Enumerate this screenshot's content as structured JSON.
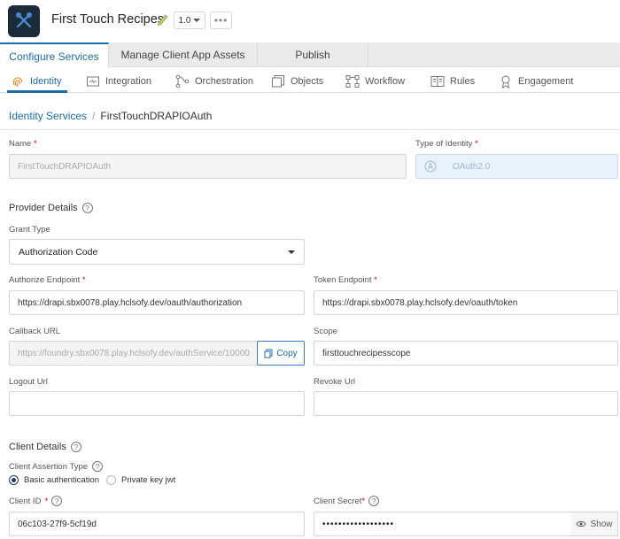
{
  "header": {
    "app_name": "First Touch Recipes",
    "version": "1.0",
    "more": "•••"
  },
  "main_tabs": [
    {
      "label": "Configure Services",
      "active": true
    },
    {
      "label": "Manage Client App Assets",
      "active": false
    },
    {
      "label": "Publish",
      "active": false
    }
  ],
  "sub_tabs": [
    {
      "label": "Identity",
      "icon": "fingerprint-icon",
      "active": true
    },
    {
      "label": "Integration",
      "icon": "integration-icon"
    },
    {
      "label": "Orchestration",
      "icon": "orchestration-icon"
    },
    {
      "label": "Objects",
      "icon": "objects-icon"
    },
    {
      "label": "Workflow",
      "icon": "workflow-icon"
    },
    {
      "label": "Rules",
      "icon": "rules-icon"
    },
    {
      "label": "Engagement",
      "icon": "engagement-icon"
    }
  ],
  "breadcrumb": {
    "parent": "Identity Services",
    "separator": "/",
    "current": "FirstTouchDRAPIOAuth"
  },
  "form": {
    "name_label": "Name",
    "name_value": "FirstTouchDRAPIOAuth",
    "type_label": "Type of Identity",
    "type_value": "OAuth2.0",
    "required_mark": "*",
    "provider_details_title": "Provider Details",
    "grant_type_label": "Grant Type",
    "grant_type_value": "Authorization Code",
    "authorize_endpoint_label": "Authorize Endpoint",
    "authorize_endpoint_value": "https://drapi.sbx0078.play.hclsofy.dev/oauth/authorization",
    "token_endpoint_label": "Token Endpoint",
    "token_endpoint_value": "https://drapi.sbx0078.play.hclsofy.dev/oauth/token",
    "callback_url_label": "Callback URL",
    "callback_url_value": "https://foundry.sbx0078.play.hclsofy.dev/authService/10000",
    "copy_label": "Copy",
    "scope_label": "Scope",
    "scope_value": "firsttouchrecipesscope",
    "logout_url_label": "Logout Url",
    "logout_url_value": "",
    "revoke_url_label": "Revoke Url",
    "revoke_url_value": "",
    "client_details_title": "Client Details",
    "client_assertion_label": "Client Assertion Type",
    "radio_basic": "Basic authentication",
    "radio_private": "Private key jwt",
    "client_id_label": "Client ID",
    "client_id_value": "06c103-27f9-5cf19d",
    "client_secret_label": "Client Secret",
    "client_secret_value": "••••••••••••••••••",
    "show_label": "Show",
    "help": "?"
  },
  "colors": {
    "accent": "#1b6ca8",
    "required": "#d0021b"
  }
}
